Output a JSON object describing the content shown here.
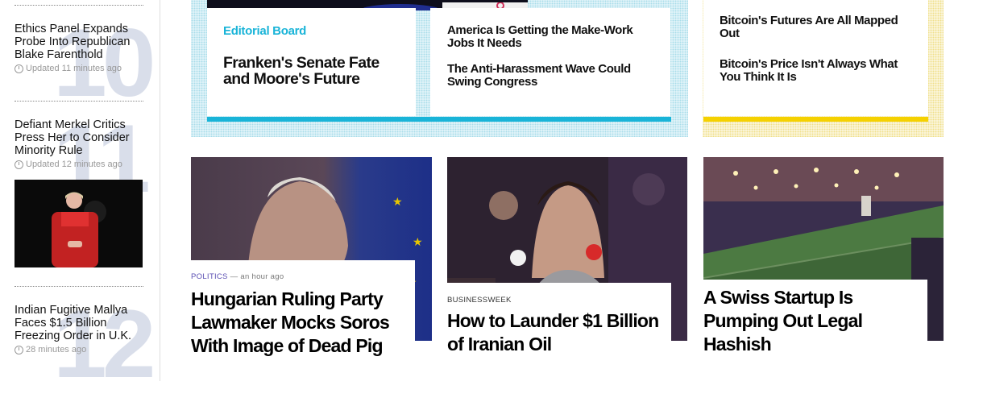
{
  "sidebar": {
    "items": [
      {
        "number": "10",
        "headline": "Ethics Panel Expands Probe Into Republican Blake Farenthold",
        "meta": "Updated 11 minutes ago"
      },
      {
        "number": "11",
        "headline": "Defiant Merkel Critics Press Her to Consider Minority Rule",
        "meta": "Updated 12 minutes ago"
      },
      {
        "number": "12",
        "headline": "Indian Fugitive Mallya Faces $1.5 Billion Freezing Order in U.K.",
        "meta": "28 minutes ago"
      }
    ]
  },
  "opinion": {
    "kicker": "Editorial Board",
    "main_headline": "Franken's Senate Fate and Moore's Future",
    "headlines": [
      "America Is Getting the Make-Work Jobs It Needs",
      "The Anti-Harassment Wave Could Swing Congress"
    ]
  },
  "markets": {
    "headlines": [
      "Bitcoin's Futures Are All Mapped Out",
      "Bitcoin's Price Isn't Always What You Think It Is"
    ]
  },
  "stories": [
    {
      "kicker": "POLITICS",
      "kicker_time": "— an hour ago",
      "headline": "Hungarian Ruling Party Lawmaker Mocks Soros With Image of Dead Pig"
    },
    {
      "kicker": "BUSINESSWEEK",
      "kicker_time": "",
      "headline": "How to Launder $1 Billion of Iranian Oil"
    },
    {
      "kicker": "",
      "kicker_time": "",
      "headline": "A Swiss Startup Is Pumping Out Legal Hashish"
    }
  ],
  "colors": {
    "accent_blue": "#19b4d8",
    "accent_yellow": "#f5d100",
    "politics_purple": "#5b4fb3"
  }
}
